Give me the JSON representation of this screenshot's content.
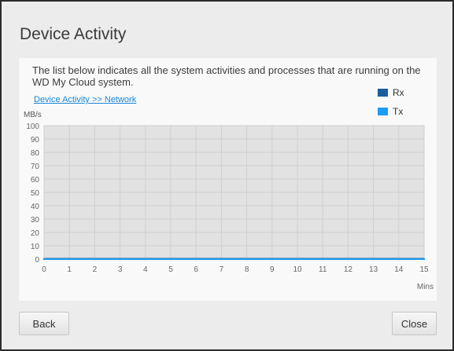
{
  "dialog": {
    "title": "Device Activity",
    "description": "The list below indicates all the system activities and processes that are running on the WD My Cloud system.",
    "network_link": "Device Activity >> Network",
    "back_label": "Back",
    "close_label": "Close"
  },
  "chart_data": {
    "type": "line",
    "ylabel": "MB/s",
    "xlabel": "Mins",
    "xlim": [
      0,
      15
    ],
    "ylim": [
      0,
      100
    ],
    "x_ticks": [
      0,
      1,
      2,
      3,
      4,
      5,
      6,
      7,
      8,
      9,
      10,
      11,
      12,
      13,
      14,
      15
    ],
    "y_ticks": [
      0,
      10,
      20,
      30,
      40,
      50,
      60,
      70,
      80,
      90,
      100
    ],
    "grid": true,
    "legend_position": "top-right",
    "series": [
      {
        "name": "Rx",
        "color": "#1b5c9c",
        "x": [
          0,
          1,
          2,
          3,
          4,
          5,
          6,
          7,
          8,
          9,
          10,
          11,
          12,
          13,
          14,
          15
        ],
        "y": [
          0,
          0,
          0,
          0,
          0,
          0,
          0,
          0,
          0,
          0,
          0,
          0,
          0,
          0,
          0,
          0
        ]
      },
      {
        "name": "Tx",
        "color": "#1e9cf0",
        "x": [
          0,
          1,
          2,
          3,
          4,
          5,
          6,
          7,
          8,
          9,
          10,
          11,
          12,
          13,
          14,
          15
        ],
        "y": [
          0,
          0,
          0,
          0,
          0,
          0,
          0,
          0,
          0,
          0,
          0,
          0,
          0,
          0,
          0,
          0
        ]
      }
    ]
  }
}
